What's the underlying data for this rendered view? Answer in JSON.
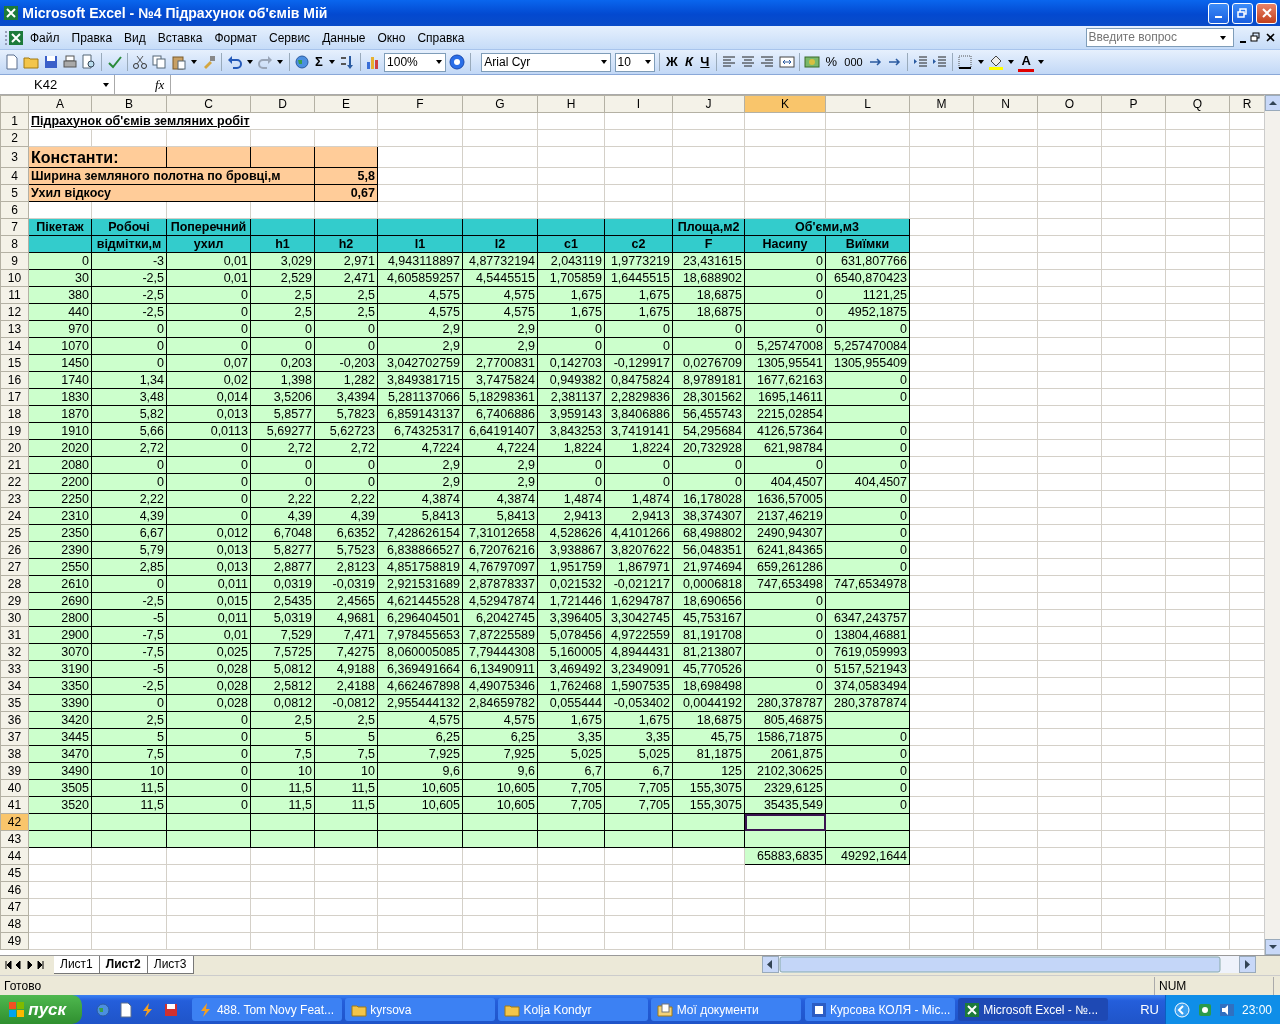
{
  "window": {
    "title": "Microsoft Excel - №4 Підрахунок об'ємів Мій"
  },
  "menu": [
    "Файл",
    "Правка",
    "Вид",
    "Вставка",
    "Формат",
    "Сервис",
    "Данные",
    "Окно",
    "Справка"
  ],
  "help_search": {
    "placeholder": "Введите вопрос"
  },
  "toolbar": {
    "sum": "Σ",
    "zoom": "100%",
    "font": "Arial Cyr",
    "size": "10",
    "bold": "Ж",
    "italic": "К",
    "underline": "Ч",
    "percent": "%",
    "thousands": "000",
    "font_color": "A"
  },
  "formula_bar": {
    "name_box": "K42",
    "function_label": "fx"
  },
  "columns": [
    {
      "label": "A",
      "selected": false
    },
    {
      "label": "B",
      "selected": false
    },
    {
      "label": "C",
      "selected": false
    },
    {
      "label": "D",
      "selected": false
    },
    {
      "label": "E",
      "selected": false
    },
    {
      "label": "F",
      "selected": false
    },
    {
      "label": "G",
      "selected": false
    },
    {
      "label": "H",
      "selected": false
    },
    {
      "label": "I",
      "selected": false
    },
    {
      "label": "J",
      "selected": false
    },
    {
      "label": "K",
      "selected": true
    },
    {
      "label": "L",
      "selected": false
    },
    {
      "label": "M",
      "selected": false
    },
    {
      "label": "N",
      "selected": false
    },
    {
      "label": "O",
      "selected": false
    },
    {
      "label": "P",
      "selected": false
    },
    {
      "label": "Q",
      "selected": false
    },
    {
      "label": "R",
      "selected": false
    }
  ],
  "rows": [
    {
      "number": "1",
      "selected": false,
      "kind": "title",
      "cells": [
        "Підрахунок об'ємів земляних робіт"
      ]
    },
    {
      "number": "2",
      "selected": false,
      "kind": "blank",
      "cells": []
    },
    {
      "number": "3",
      "selected": false,
      "kind": "group_heading",
      "cells": [
        "Константи:",
        null,
        null,
        null,
        null
      ]
    },
    {
      "number": "4",
      "selected": false,
      "kind": "constant",
      "cells": [
        "Ширина земляного полотна по бровці,м",
        null,
        null,
        null,
        "5,8"
      ]
    },
    {
      "number": "5",
      "selected": false,
      "kind": "constant",
      "cells": [
        "Ухил відкосу",
        null,
        null,
        null,
        "0,67"
      ]
    },
    {
      "number": "6",
      "selected": false,
      "kind": "blank",
      "cells": []
    },
    {
      "number": "7",
      "selected": false,
      "kind": "header_top",
      "cells": [
        "Пікетаж",
        "Робочі",
        "Поперечний",
        null,
        null,
        null,
        null,
        null,
        null,
        "Площа,м2",
        "Об'єми,м3",
        null
      ]
    },
    {
      "number": "8",
      "selected": false,
      "kind": "header",
      "cells": [
        null,
        "відмітки,м",
        "ухил",
        "h1",
        "h2",
        "l1",
        "l2",
        "c1",
        "c2",
        "F",
        "Насипу",
        "Виїмки"
      ]
    },
    {
      "number": "9",
      "selected": false,
      "kind": "data",
      "cells": [
        "0",
        "-3",
        "0,01",
        "3,029",
        "2,971",
        "4,943118897",
        "4,87732194",
        "2,043119",
        "1,9773219",
        "23,431615",
        "0",
        "631,807766"
      ]
    },
    {
      "number": "10",
      "selected": false,
      "kind": "data",
      "cells": [
        "30",
        "-2,5",
        "0,01",
        "2,529",
        "2,471",
        "4,605859257",
        "4,5445515",
        "1,705859",
        "1,6445515",
        "18,688902",
        "0",
        "6540,870423"
      ]
    },
    {
      "number": "11",
      "selected": false,
      "kind": "data",
      "cells": [
        "380",
        "-2,5",
        "0",
        "2,5",
        "2,5",
        "4,575",
        "4,575",
        "1,675",
        "1,675",
        "18,6875",
        "0",
        "1121,25"
      ]
    },
    {
      "number": "12",
      "selected": false,
      "kind": "data",
      "cells": [
        "440",
        "-2,5",
        "0",
        "2,5",
        "2,5",
        "4,575",
        "4,575",
        "1,675",
        "1,675",
        "18,6875",
        "0",
        "4952,1875"
      ]
    },
    {
      "number": "13",
      "selected": false,
      "kind": "data",
      "cells": [
        "970",
        "0",
        "0",
        "0",
        "0",
        "2,9",
        "2,9",
        "0",
        "0",
        "0",
        "0",
        "0"
      ]
    },
    {
      "number": "14",
      "selected": false,
      "kind": "data",
      "cells": [
        "1070",
        "0",
        "0",
        "0",
        "0",
        "2,9",
        "2,9",
        "0",
        "0",
        "0",
        "5,25747008",
        "5,257470084"
      ]
    },
    {
      "number": "15",
      "selected": false,
      "kind": "data",
      "cells": [
        "1450",
        "0",
        "0,07",
        "0,203",
        "-0,203",
        "3,042702759",
        "2,7700831",
        "0,142703",
        "-0,129917",
        "0,0276709",
        "1305,95541",
        "1305,955409"
      ]
    },
    {
      "number": "16",
      "selected": false,
      "kind": "data",
      "cells": [
        "1740",
        "1,34",
        "0,02",
        "1,398",
        "1,282",
        "3,849381715",
        "3,7475824",
        "0,949382",
        "0,8475824",
        "8,9789181",
        "1677,62163",
        "0"
      ]
    },
    {
      "number": "17",
      "selected": false,
      "kind": "data",
      "cells": [
        "1830",
        "3,48",
        "0,014",
        "3,5206",
        "3,4394",
        "5,281137066",
        "5,18298361",
        "2,381137",
        "2,2829836",
        "28,301562",
        "1695,14611",
        "0"
      ]
    },
    {
      "number": "18",
      "selected": false,
      "kind": "data",
      "cells": [
        "1870",
        "5,82",
        "0,013",
        "5,8577",
        "5,7823",
        "6,859143137",
        "6,7406886",
        "3,959143",
        "3,8406886",
        "56,455743",
        "2215,02854",
        null
      ]
    },
    {
      "number": "19",
      "selected": false,
      "kind": "data",
      "cells": [
        "1910",
        "5,66",
        "0,0113",
        "5,69277",
        "5,62723",
        "6,74325317",
        "6,64191407",
        "3,843253",
        "3,7419141",
        "54,295684",
        "4126,57364",
        "0"
      ]
    },
    {
      "number": "20",
      "selected": false,
      "kind": "data",
      "cells": [
        "2020",
        "2,72",
        "0",
        "2,72",
        "2,72",
        "4,7224",
        "4,7224",
        "1,8224",
        "1,8224",
        "20,732928",
        "621,98784",
        "0"
      ]
    },
    {
      "number": "21",
      "selected": false,
      "kind": "data",
      "cells": [
        "2080",
        "0",
        "0",
        "0",
        "0",
        "2,9",
        "2,9",
        "0",
        "0",
        "0",
        "0",
        "0"
      ]
    },
    {
      "number": "22",
      "selected": false,
      "kind": "data",
      "cells": [
        "2200",
        "0",
        "0",
        "0",
        "0",
        "2,9",
        "2,9",
        "0",
        "0",
        "0",
        "404,4507",
        "404,4507"
      ]
    },
    {
      "number": "23",
      "selected": false,
      "kind": "data",
      "cells": [
        "2250",
        "2,22",
        "0",
        "2,22",
        "2,22",
        "4,3874",
        "4,3874",
        "1,4874",
        "1,4874",
        "16,178028",
        "1636,57005",
        "0"
      ]
    },
    {
      "number": "24",
      "selected": false,
      "kind": "data",
      "cells": [
        "2310",
        "4,39",
        "0",
        "4,39",
        "4,39",
        "5,8413",
        "5,8413",
        "2,9413",
        "2,9413",
        "38,374307",
        "2137,46219",
        "0"
      ]
    },
    {
      "number": "25",
      "selected": false,
      "kind": "data",
      "cells": [
        "2350",
        "6,67",
        "0,012",
        "6,7048",
        "6,6352",
        "7,428626154",
        "7,31012658",
        "4,528626",
        "4,4101266",
        "68,498802",
        "2490,94307",
        "0"
      ]
    },
    {
      "number": "26",
      "selected": false,
      "kind": "data",
      "cells": [
        "2390",
        "5,79",
        "0,013",
        "5,8277",
        "5,7523",
        "6,838866527",
        "6,72076216",
        "3,938867",
        "3,8207622",
        "56,048351",
        "6241,84365",
        "0"
      ]
    },
    {
      "number": "27",
      "selected": false,
      "kind": "data",
      "cells": [
        "2550",
        "2,85",
        "0,013",
        "2,8877",
        "2,8123",
        "4,851758819",
        "4,76797097",
        "1,951759",
        "1,867971",
        "21,974694",
        "659,261286",
        "0"
      ]
    },
    {
      "number": "28",
      "selected": false,
      "kind": "data",
      "cells": [
        "2610",
        "0",
        "0,011",
        "0,0319",
        "-0,0319",
        "2,921531689",
        "2,87878337",
        "0,021532",
        "-0,021217",
        "0,0006818",
        "747,653498",
        "747,6534978"
      ]
    },
    {
      "number": "29",
      "selected": false,
      "kind": "data",
      "cells": [
        "2690",
        "-2,5",
        "0,015",
        "2,5435",
        "2,4565",
        "4,621445528",
        "4,52947874",
        "1,721446",
        "1,6294787",
        "18,690656",
        "0",
        null
      ]
    },
    {
      "number": "30",
      "selected": false,
      "kind": "data",
      "cells": [
        "2800",
        "-5",
        "0,011",
        "5,0319",
        "4,9681",
        "6,296404501",
        "6,2042745",
        "3,396405",
        "3,3042745",
        "45,753167",
        "0",
        "6347,243757"
      ]
    },
    {
      "number": "31",
      "selected": false,
      "kind": "data",
      "cells": [
        "2900",
        "-7,5",
        "0,01",
        "7,529",
        "7,471",
        "7,978455653",
        "7,87225589",
        "5,078456",
        "4,9722559",
        "81,191708",
        "0",
        "13804,46881"
      ]
    },
    {
      "number": "32",
      "selected": false,
      "kind": "data",
      "cells": [
        "3070",
        "-7,5",
        "0,025",
        "7,5725",
        "7,4275",
        "8,060005085",
        "7,79444308",
        "5,160005",
        "4,8944431",
        "81,213807",
        "0",
        "7619,059993"
      ]
    },
    {
      "number": "33",
      "selected": false,
      "kind": "data",
      "cells": [
        "3190",
        "-5",
        "0,028",
        "5,0812",
        "4,9188",
        "6,369491664",
        "6,13490911",
        "3,469492",
        "3,2349091",
        "45,770526",
        "0",
        "5157,521943"
      ]
    },
    {
      "number": "34",
      "selected": false,
      "kind": "data",
      "cells": [
        "3350",
        "-2,5",
        "0,028",
        "2,5812",
        "2,4188",
        "4,662467898",
        "4,49075346",
        "1,762468",
        "1,5907535",
        "18,698498",
        "0",
        "374,0583494"
      ]
    },
    {
      "number": "35",
      "selected": false,
      "kind": "data",
      "cells": [
        "3390",
        "0",
        "0,028",
        "0,0812",
        "-0,0812",
        "2,955444132",
        "2,84659782",
        "0,055444",
        "-0,053402",
        "0,0044192",
        "280,378787",
        "280,3787874"
      ]
    },
    {
      "number": "36",
      "selected": false,
      "kind": "data",
      "cells": [
        "3420",
        "2,5",
        "0",
        "2,5",
        "2,5",
        "4,575",
        "4,575",
        "1,675",
        "1,675",
        "18,6875",
        "805,46875",
        null
      ]
    },
    {
      "number": "37",
      "selected": false,
      "kind": "data",
      "cells": [
        "3445",
        "5",
        "0",
        "5",
        "5",
        "6,25",
        "6,25",
        "3,35",
        "3,35",
        "45,75",
        "1586,71875",
        "0"
      ]
    },
    {
      "number": "38",
      "selected": false,
      "kind": "data",
      "cells": [
        "3470",
        "7,5",
        "0",
        "7,5",
        "7,5",
        "7,925",
        "7,925",
        "5,025",
        "5,025",
        "81,1875",
        "2061,875",
        "0"
      ]
    },
    {
      "number": "39",
      "selected": false,
      "kind": "data",
      "cells": [
        "3490",
        "10",
        "0",
        "10",
        "10",
        "9,6",
        "9,6",
        "6,7",
        "6,7",
        "125",
        "2102,30625",
        "0"
      ]
    },
    {
      "number": "40",
      "selected": false,
      "kind": "data",
      "cells": [
        "3505",
        "11,5",
        "0",
        "11,5",
        "11,5",
        "10,605",
        "10,605",
        "7,705",
        "7,705",
        "155,3075",
        "2329,6125",
        "0"
      ]
    },
    {
      "number": "41",
      "selected": false,
      "kind": "data",
      "cells": [
        "3520",
        "11,5",
        "0",
        "11,5",
        "11,5",
        "10,605",
        "10,605",
        "7,705",
        "7,705",
        "155,3075",
        "35435,549",
        "0"
      ]
    },
    {
      "number": "42",
      "selected": true,
      "kind": "data",
      "cells": [
        null,
        null,
        null,
        null,
        null,
        null,
        null,
        null,
        null,
        null,
        null,
        null
      ]
    },
    {
      "number": "43",
      "selected": false,
      "kind": "data",
      "cells": [
        null,
        null,
        null,
        null,
        null,
        null,
        null,
        null,
        null,
        null,
        null,
        null
      ]
    },
    {
      "number": "44",
      "selected": false,
      "kind": "total",
      "cells": [
        null,
        null,
        null,
        null,
        null,
        null,
        null,
        null,
        null,
        null,
        "65883,6835",
        "49292,1644"
      ]
    },
    {
      "number": "45",
      "selected": false,
      "kind": "blank",
      "cells": []
    },
    {
      "number": "46",
      "selected": false,
      "kind": "blank",
      "cells": []
    },
    {
      "number": "47",
      "selected": false,
      "kind": "blank",
      "cells": []
    },
    {
      "number": "48",
      "selected": false,
      "kind": "blank",
      "cells": []
    },
    {
      "number": "49",
      "selected": false,
      "kind": "blank",
      "cells": []
    }
  ],
  "sheet_tabs": [
    {
      "label": "Лист1",
      "selected": false
    },
    {
      "label": "Лист2",
      "selected": true
    },
    {
      "label": "Лист3",
      "selected": false
    }
  ],
  "status_bar": {
    "text": "Готово",
    "indicator": "NUM"
  },
  "taskbar": {
    "start": "пуск",
    "tasks": [
      {
        "label": "488. Tom Novy Feat...",
        "kind": "media",
        "selected": false
      },
      {
        "label": "kyrsova",
        "kind": "folder",
        "selected": false
      },
      {
        "label": "Kolja Kondyr",
        "kind": "folder",
        "selected": false
      },
      {
        "label": "Мої документи",
        "kind": "documents",
        "selected": false
      },
      {
        "label": "Курсова КОЛЯ - Mic...",
        "kind": "word",
        "selected": false
      },
      {
        "label": "Microsoft Excel - №...",
        "kind": "excel",
        "selected": true
      }
    ],
    "language": "RU",
    "clock": "23:00"
  }
}
